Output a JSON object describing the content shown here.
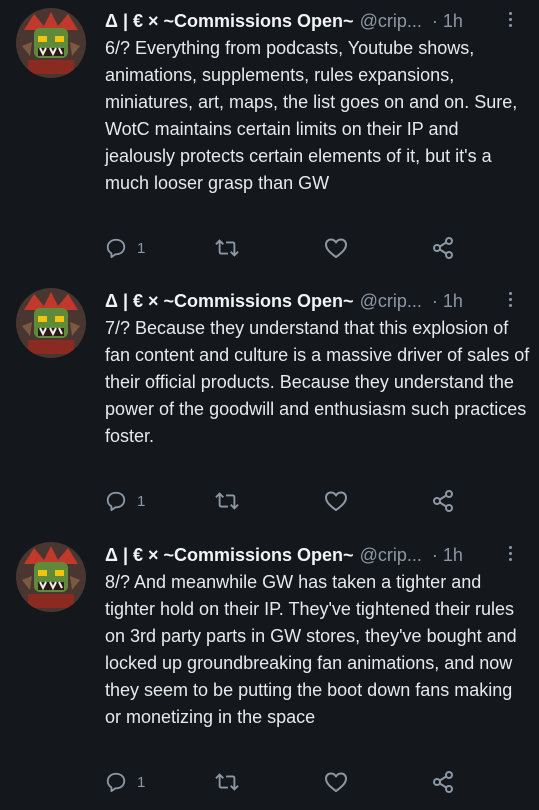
{
  "tweets": [
    {
      "name": "Δ | € × ~Commissions Open~",
      "handle": "@crip...",
      "time": "· 1h",
      "text": "6/? Everything from podcasts, Youtube shows,  animations, supplements, rules expansions, miniatures, art, maps, the list goes on and on. Sure, WotC maintains certain limits on their IP and jealously protects certain elements of it, but it's a much looser grasp than GW",
      "reply_count": "1"
    },
    {
      "name": "Δ | € × ~Commissions Open~",
      "handle": "@crip...",
      "time": "· 1h",
      "text": "7/? Because they understand that this explosion of fan content and culture is a massive driver of sales of their official products. Because they understand the power of the goodwill and enthusiasm such practices foster.",
      "reply_count": "1"
    },
    {
      "name": "Δ | € × ~Commissions Open~",
      "handle": "@crip...",
      "time": "· 1h",
      "text": "8/? And meanwhile GW has taken a tighter and tighter hold on their IP. They've tightened their rules on 3rd party parts in GW stores, they've bought and locked up groundbreaking fan animations, and now they seem to be putting the boot down fans making or monetizing in the space",
      "reply_count": "1"
    }
  ],
  "icons": {
    "reply": "reply-icon",
    "retweet": "retweet-icon",
    "like": "heart-icon",
    "share": "share-icon",
    "more": "more-options-icon"
  },
  "colors": {
    "background": "#14171c",
    "text": "#e7e9ea",
    "secondary": "#8b98a5"
  }
}
